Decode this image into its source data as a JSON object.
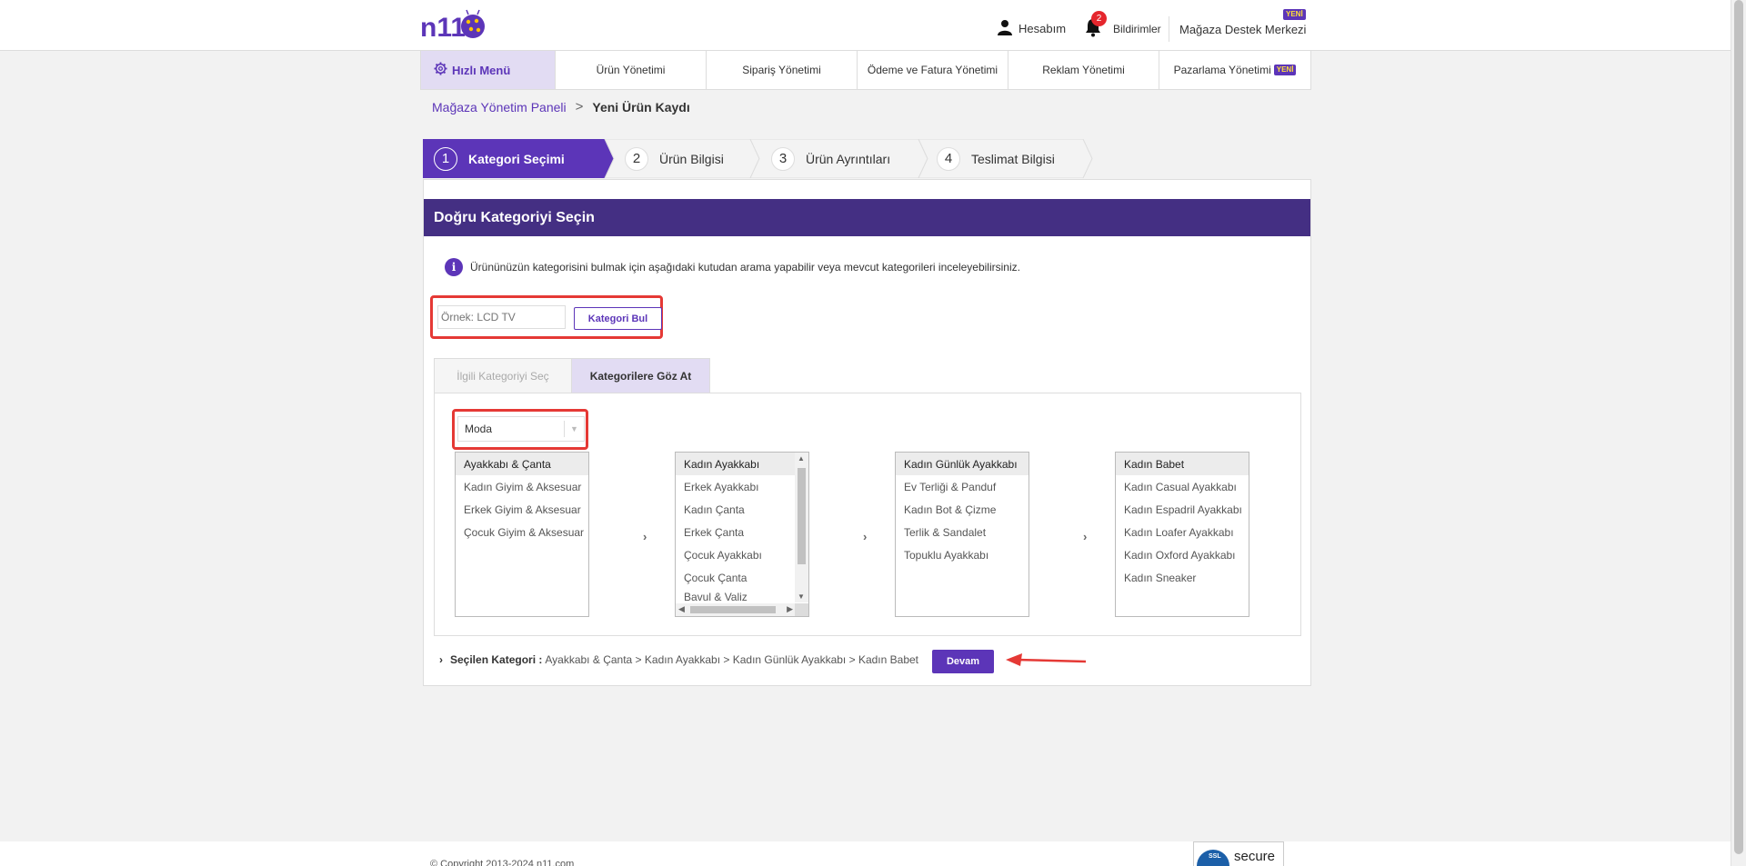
{
  "header": {
    "logo_text": "n11",
    "account_label": "Hesabım",
    "notification_count": "2",
    "notifications_label": "Bildirimler",
    "support_label": "Mağaza Destek Merkezi",
    "support_badge": "YENİ"
  },
  "nav": {
    "quick_menu": "Hızlı Menü",
    "items": [
      "Ürün Yönetimi",
      "Sipariş Yönetimi",
      "Ödeme ve Fatura Yönetimi",
      "Reklam Yönetimi",
      "Pazarlama Yönetimi"
    ],
    "marketing_badge": "YENİ"
  },
  "breadcrumb": {
    "parent": "Mağaza Yönetim Paneli",
    "separator": ">",
    "current": "Yeni Ürün Kaydı"
  },
  "steps": [
    {
      "num": "1",
      "label": "Kategori Seçimi",
      "active": true
    },
    {
      "num": "2",
      "label": "Ürün Bilgisi",
      "active": false
    },
    {
      "num": "3",
      "label": "Ürün Ayrıntıları",
      "active": false
    },
    {
      "num": "4",
      "label": "Teslimat Bilgisi",
      "active": false
    }
  ],
  "panel": {
    "title": "Doğru Kategoriyi Seçin",
    "info_text": "Ürününüzün kategorisini bulmak için aşağıdaki kutudan arama yapabilir veya mevcut kategorileri inceleyebilirsiniz."
  },
  "search": {
    "value": "",
    "placeholder": "Örnek: LCD TV",
    "button_label": "Kategori Bul"
  },
  "tabs": {
    "related": "İlgili Kategoriyi Seç",
    "browse": "Kategorilere Göz At"
  },
  "dropdown": {
    "selected": "Moda"
  },
  "columns": [
    {
      "items": [
        "Ayakkabı & Çanta",
        "Kadın Giyim & Aksesuar",
        "Erkek Giyim & Aksesuar",
        "Çocuk Giyim & Aksesuar"
      ],
      "selected": 0
    },
    {
      "items": [
        "Kadın Ayakkabı",
        "Erkek Ayakkabı",
        "Kadın Çanta",
        "Erkek Çanta",
        "Çocuk Ayakkabı",
        "Çocuk Çanta",
        "Bavul & Valiz"
      ],
      "selected": 0
    },
    {
      "items": [
        "Kadın Günlük Ayakkabı",
        "Ev Terliği & Panduf",
        "Kadın Bot & Çizme",
        "Terlik & Sandalet",
        "Topuklu Ayakkabı"
      ],
      "selected": 0
    },
    {
      "items": [
        "Kadın Babet",
        "Kadın Casual Ayakkabı",
        "Kadın Espadril Ayakkabı",
        "Kadın Loafer Ayakkabı",
        "Kadın Oxford Ayakkabı",
        "Kadın Sneaker"
      ],
      "selected": 0
    }
  ],
  "column_separator": "›",
  "selection": {
    "chevron": "›",
    "label": "Seçilen Kategori :",
    "path": "Ayakkabı & Çanta > Kadın Ayakkabı > Kadın Günlük Ayakkabı > Kadın Babet",
    "continue_button": "Devam"
  },
  "footer": {
    "copyright": "© Copyright 2013-2024 n11.com",
    "ssl_badge": "SSL",
    "ssl_secure": "secure"
  },
  "colors": {
    "brand_purple": "#5c35b8",
    "header_purple": "#442f83",
    "highlight_red": "#e53935"
  },
  "icons": {
    "account": "user-icon",
    "notifications": "bell-icon",
    "quick_menu": "gear-icon",
    "info": "info-icon",
    "dropdown": "chevron-down-icon"
  }
}
